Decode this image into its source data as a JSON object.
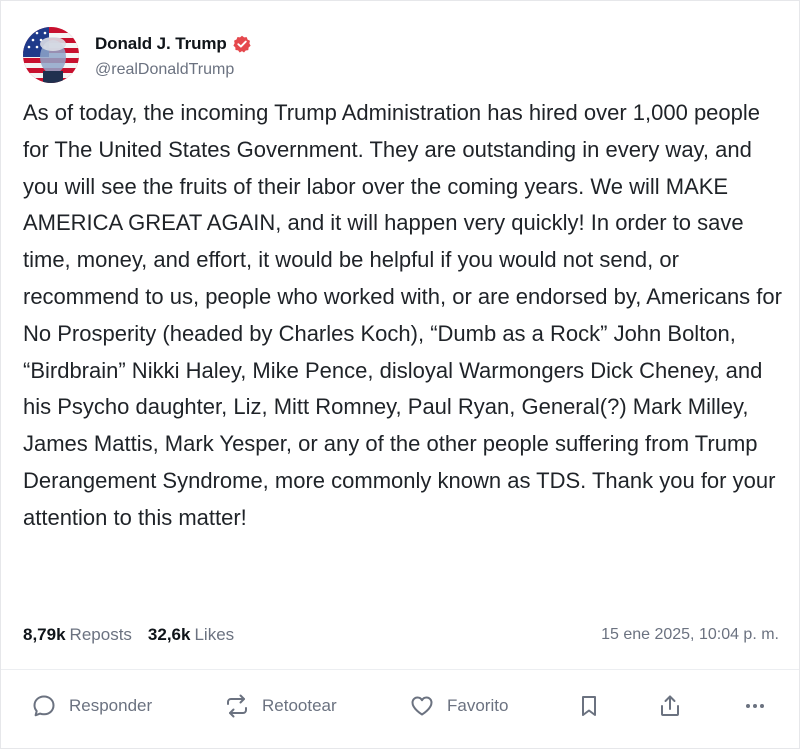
{
  "post": {
    "author": {
      "display_name": "Donald J. Trump",
      "handle": "@realDonaldTrump",
      "verified": true,
      "verified_color": "#e5484d"
    },
    "text": "As of today, the incoming Trump Administration has hired over 1,000 people for The United States Government. They are outstanding in every way, and you will see the fruits of their labor over the coming years. We will MAKE AMERICA GREAT AGAIN, and it will happen very quickly! In order to save time, money, and effort, it would be helpful if you would not send, or recommend to us, people who worked with, or are endorsed by, Americans for No Prosperity (headed by Charles Koch), “Dumb as a Rock” John Bolton, “Birdbrain” Nikki Haley, Mike Pence, disloyal Warmongers Dick Cheney, and his Psycho daughter, Liz, Mitt Romney, Paul Ryan, General(?) Mark Milley, James Mattis, Mark Yesper, or any of the other people suffering from Trump Derangement Syndrome, more commonly known as TDS. Thank you for your attention to this matter!",
    "stats": {
      "reposts_count": "8,79k",
      "reposts_label": "Reposts",
      "likes_count": "32,6k",
      "likes_label": "Likes"
    },
    "timestamp": "15 ene 2025, 10:04 p. m."
  },
  "actions": {
    "reply_label": "Responder",
    "retruth_label": "Retootear",
    "favorite_label": "Favorito",
    "icons": [
      "speech-bubble-icon",
      "retruth-arrows-icon",
      "heart-icon",
      "bookmark-icon",
      "share-icon",
      "more-icon"
    ]
  },
  "colors": {
    "text_primary": "#0f1419",
    "text_secondary": "#6b7280",
    "border": "#e6e7ea"
  }
}
